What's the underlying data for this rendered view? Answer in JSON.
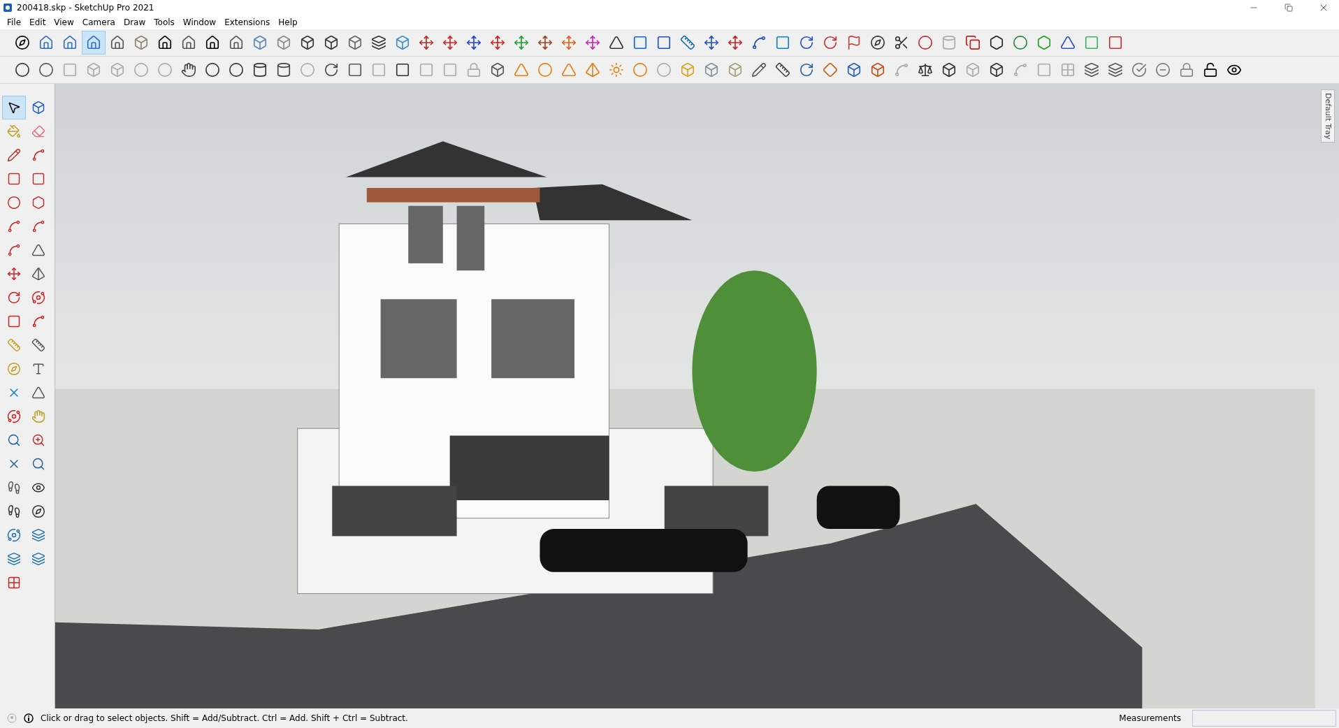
{
  "window": {
    "title": "200418.skp - SketchUp Pro 2021"
  },
  "menu": [
    "File",
    "Edit",
    "View",
    "Camera",
    "Draw",
    "Tools",
    "Window",
    "Extensions",
    "Help"
  ],
  "tray": {
    "label": "Default Tray"
  },
  "status_bar": {
    "hint": "Click or drag to select objects. Shift = Add/Subtract. Ctrl = Add. Shift + Ctrl = Subtract.",
    "measurements_label": "Measurements"
  }
}
